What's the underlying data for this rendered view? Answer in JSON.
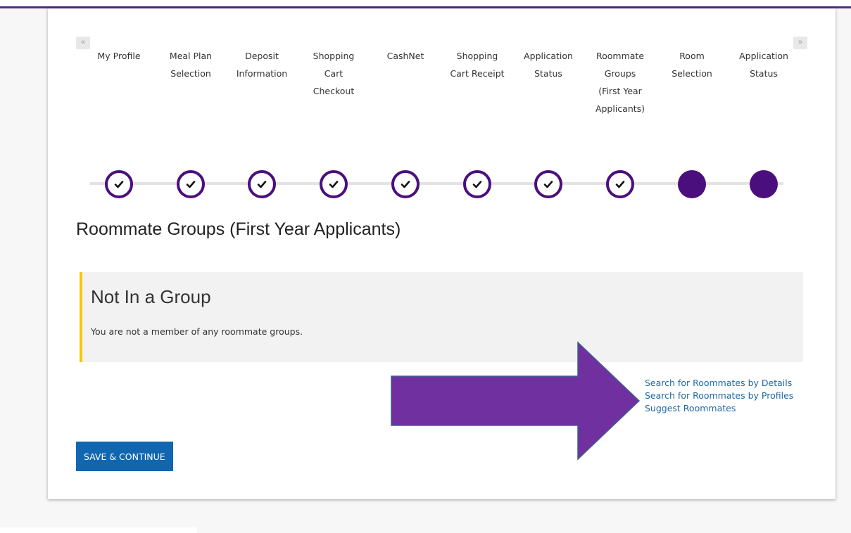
{
  "colors": {
    "accent": "#4b0f7d",
    "link": "#1f67a6",
    "button": "#1166b0",
    "highlight": "#f6c800",
    "arrow": "#7030a0"
  },
  "steps": [
    {
      "label": "My Profile",
      "status": "done"
    },
    {
      "label": "Meal Plan\nSelection",
      "status": "done"
    },
    {
      "label": "Deposit\nInformation",
      "status": "done"
    },
    {
      "label": "Shopping\nCart\nCheckout",
      "status": "done"
    },
    {
      "label": "CashNet",
      "status": "done"
    },
    {
      "label": "Shopping\nCart Receipt",
      "status": "done"
    },
    {
      "label": "Application\nStatus",
      "status": "done"
    },
    {
      "label": "Roommate\nGroups\n(First Year\nApplicants)",
      "status": "done"
    },
    {
      "label": "Room\nSelection",
      "status": "pending"
    },
    {
      "label": "Application\nStatus",
      "status": "pending"
    }
  ],
  "nav": {
    "prev": "«",
    "next": "»"
  },
  "page_title": "Roommate Groups (First Year Applicants)",
  "status_panel": {
    "title": "Not In a Group",
    "message": "You are not a member of any roommate groups."
  },
  "links": [
    "Search for Roommates by Details",
    "Search for Roommates by Profiles",
    "Suggest Roommates"
  ],
  "save_button": "SAVE & CONTINUE"
}
